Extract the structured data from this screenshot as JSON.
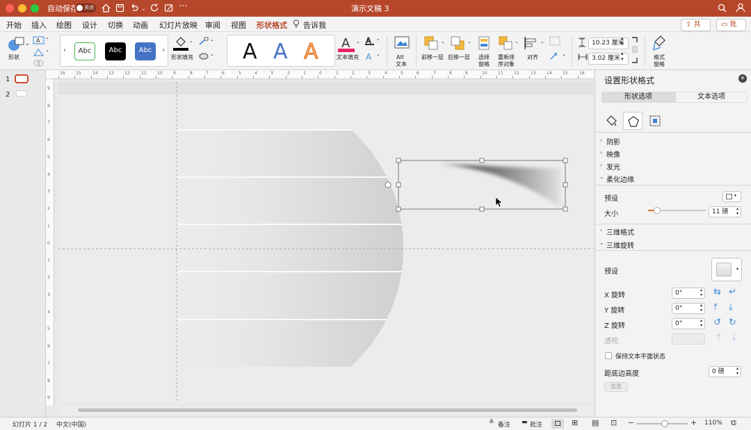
{
  "titlebar": {
    "autosave_label": "自动保存",
    "autosave_state": "关闭",
    "doc_title": "演示文稿 3"
  },
  "menu": {
    "tabs": [
      "开始",
      "插入",
      "绘图",
      "设计",
      "切换",
      "动画",
      "幻灯片放映",
      "审阅",
      "视图",
      "形状格式"
    ],
    "tell_me": "告诉我",
    "share": "共享",
    "comment": "批注"
  },
  "ribbon": {
    "shape_label": "形状",
    "style_samples": [
      "Abc",
      "Abc",
      "Abc"
    ],
    "shape_fill": "形状填充",
    "text_fill": "文本填充",
    "wordart": [
      "A",
      "A",
      "A"
    ],
    "alt_text_1": "Alt",
    "alt_text_2": "文本",
    "bring_forward": "前移一层",
    "send_backward": "后移一层",
    "selection_pane_1": "选择",
    "selection_pane_2": "窗格",
    "reorder_1": "重新排",
    "reorder_2": "序对象",
    "align": "对齐",
    "height": "10.23 厘米",
    "width": "3.02 厘米",
    "format_pane_1": "格式",
    "format_pane_2": "窗格"
  },
  "slides": {
    "items": [
      "1",
      "2"
    ]
  },
  "panel": {
    "title": "设置形状格式",
    "tab_shape": "形状选项",
    "tab_text": "文本选项",
    "sections": {
      "shadow": "阴影",
      "reflection": "映像",
      "glow": "发光",
      "soft_edges": "柔化边缘",
      "format3d": "三维格式",
      "rotation3d": "三维旋转"
    },
    "soft_preset": "预设",
    "soft_size_label": "大小",
    "soft_size": "11 磅",
    "soft_size_fraction": 0.05,
    "rot_preset": "预设",
    "x_label": "X 旋转",
    "x_value": "0°",
    "y_label": "Y 旋转",
    "y_value": "0°",
    "z_label": "Z 旋转",
    "z_value": "0°",
    "perspective_label": "透视",
    "keep_flat": "保持文本平面状态",
    "distance_label": "距底边高度",
    "distance_value": "0 磅",
    "reset": "重置"
  },
  "status": {
    "slide": "幻灯片 1 / 2",
    "lang": "中文(中国)",
    "notes": "备注",
    "comments": "批注",
    "zoom": "110%",
    "zoom_fraction": 0.55
  },
  "ruler": {
    "h": [
      "16",
      "15",
      "14",
      "13",
      "12",
      "11",
      "10",
      "9",
      "8",
      "7",
      "6",
      "5",
      "4",
      "3",
      "2",
      "1",
      "0",
      "1",
      "2",
      "3",
      "4",
      "5",
      "6",
      "7",
      "8",
      "9",
      "10",
      "11",
      "12",
      "13",
      "14",
      "15",
      "16"
    ],
    "v": [
      "9",
      "8",
      "7",
      "6",
      "5",
      "4",
      "3",
      "2",
      "1",
      "0",
      "1",
      "2",
      "3",
      "4",
      "5",
      "6",
      "7",
      "8",
      "9"
    ]
  },
  "colors": {
    "accent": "#b7472a",
    "blue": "#3d86d8"
  }
}
